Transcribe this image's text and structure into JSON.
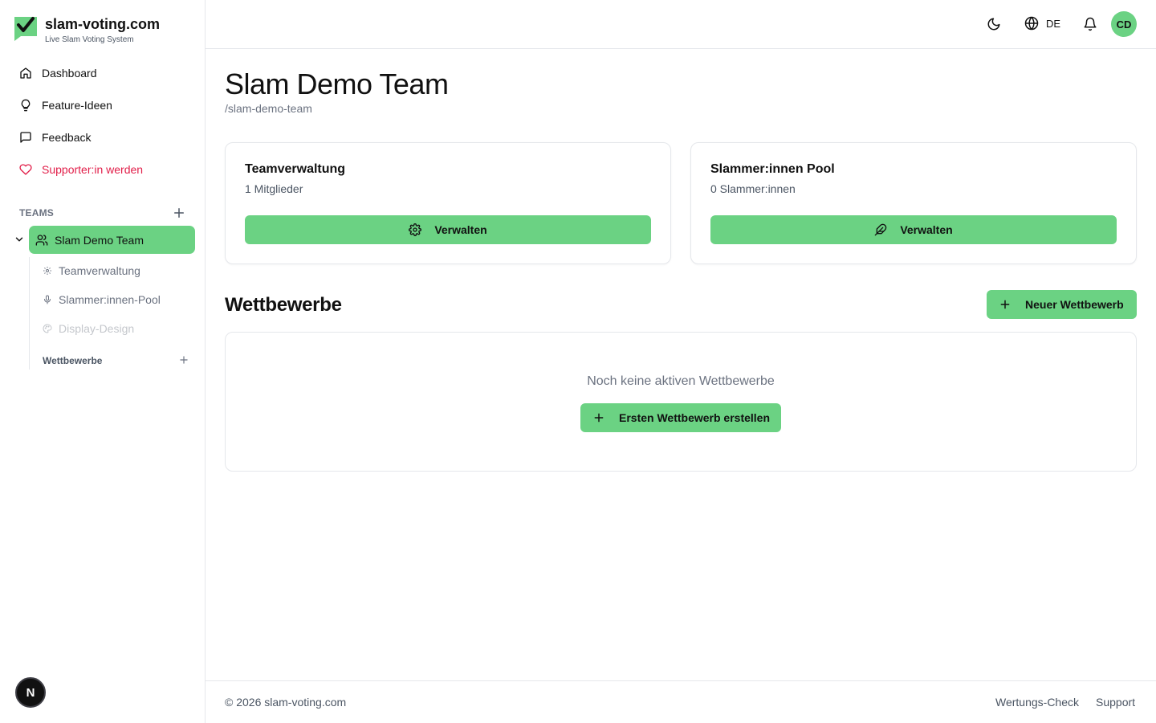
{
  "brand": {
    "name": "slam-voting.com",
    "tagline": "Live Slam Voting System",
    "accent_color": "#6bd283",
    "logo_icon": "check-bubble-icon"
  },
  "sidebar": {
    "nav": [
      {
        "label": "Dashboard",
        "icon": "home-icon"
      },
      {
        "label": "Feature-Ideen",
        "icon": "lightbulb-icon"
      },
      {
        "label": "Feedback",
        "icon": "message-square-icon"
      },
      {
        "label": "Supporter:in werden",
        "icon": "heart-icon",
        "color": "#e11d48"
      }
    ],
    "teams_label": "TEAMS",
    "active_team": "Slam Demo Team",
    "team_children": [
      {
        "label": "Teamverwaltung",
        "icon": "gear-icon",
        "enabled": true
      },
      {
        "label": "Slammer:innen-Pool",
        "icon": "microphone-icon",
        "enabled": true
      },
      {
        "label": "Display-Design",
        "icon": "palette-icon",
        "enabled": false
      }
    ],
    "competitions_label": "Wettbewerbe",
    "next_badge": "N"
  },
  "header": {
    "language": "DE",
    "avatar_initials": "CD"
  },
  "main": {
    "title": "Slam Demo Team",
    "slug": "/slam-demo-team",
    "cards": [
      {
        "title": "Teamverwaltung",
        "subtitle": "1 Mitglieder",
        "button": "Verwalten",
        "button_icon": "gear-icon"
      },
      {
        "title": "Slammer:innen Pool",
        "subtitle": "0 Slammer:innen",
        "button": "Verwalten",
        "button_icon": "feather-icon"
      }
    ],
    "competitions": {
      "title": "Wettbewerbe",
      "new_button": "Neuer Wettbewerb",
      "empty_text": "Noch keine aktiven Wettbewerbe",
      "empty_button": "Ersten Wettbewerb erstellen"
    }
  },
  "footer": {
    "copyright": "© 2026 slam-voting.com",
    "links": [
      "Wertungs-Check",
      "Support"
    ]
  }
}
